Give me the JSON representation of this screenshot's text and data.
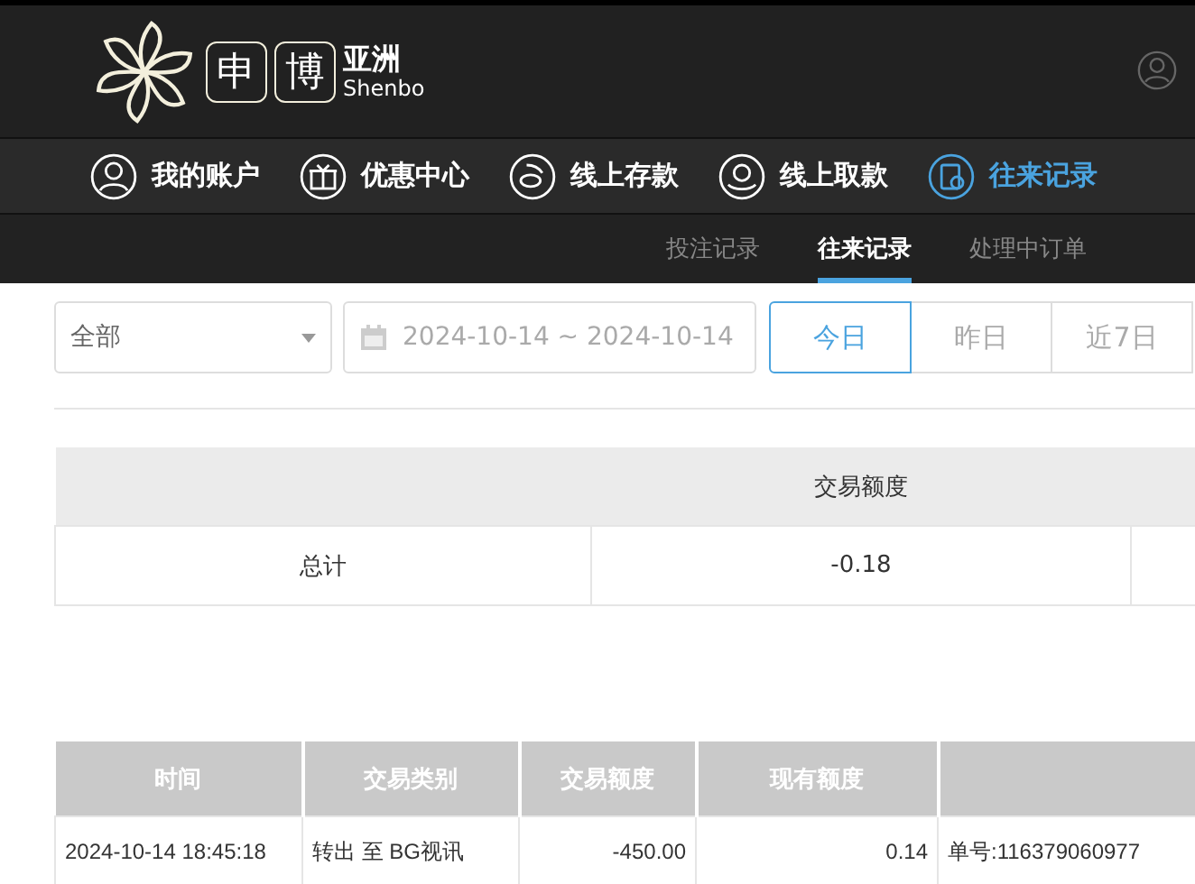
{
  "logo": {
    "chars": [
      "申",
      "博"
    ],
    "region": "亚洲",
    "latin": "Shenbo"
  },
  "nav": [
    {
      "label": "我的账户",
      "kind": "person",
      "selected": false
    },
    {
      "label": "优惠中心",
      "kind": "gift",
      "selected": false
    },
    {
      "label": "线上存款",
      "kind": "deposit",
      "selected": false
    },
    {
      "label": "线上取款",
      "kind": "withdraw",
      "selected": false
    },
    {
      "label": "往来记录",
      "kind": "records",
      "selected": true
    }
  ],
  "subnav": [
    {
      "label": "投注记录",
      "selected": false
    },
    {
      "label": "往来记录",
      "selected": true
    },
    {
      "label": "处理中订单",
      "selected": false
    }
  ],
  "filter": {
    "type_select": "全部",
    "date_range": "2024-10-14 ~ 2024-10-14",
    "quick": [
      {
        "label": "今日",
        "selected": true
      },
      {
        "label": "昨日",
        "selected": false
      },
      {
        "label": "近7日",
        "selected": false
      }
    ]
  },
  "summary": {
    "columns": [
      "交易额度"
    ],
    "row": [
      "总计",
      "-0.18"
    ]
  },
  "table": {
    "columns": [
      "时间",
      "交易类别",
      "交易额度",
      "现有额度"
    ],
    "rows": [
      [
        "2024-10-14 18:45:18",
        "转出 至 BG视讯",
        "-450.00",
        "0.14",
        "单号:116379060977"
      ]
    ]
  }
}
